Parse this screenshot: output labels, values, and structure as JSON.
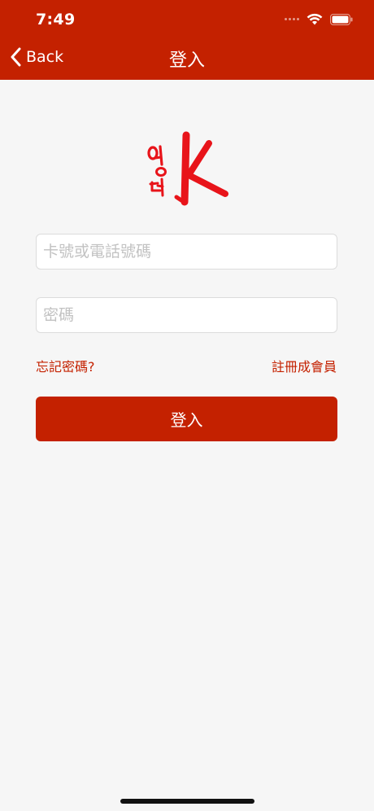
{
  "status_bar": {
    "time": "7:49"
  },
  "nav": {
    "back_label": "Back",
    "title": "登入"
  },
  "logo": {
    "icon": "brand-logo"
  },
  "form": {
    "card_phone_placeholder": "卡號或電話號碼",
    "password_placeholder": "密碼",
    "forgot_password": "忘記密碼?",
    "register": "註冊成會員",
    "submit": "登入"
  },
  "colors": {
    "brand": "#c42100",
    "background": "#f6f6f6",
    "logo_red": "#e8141a"
  }
}
